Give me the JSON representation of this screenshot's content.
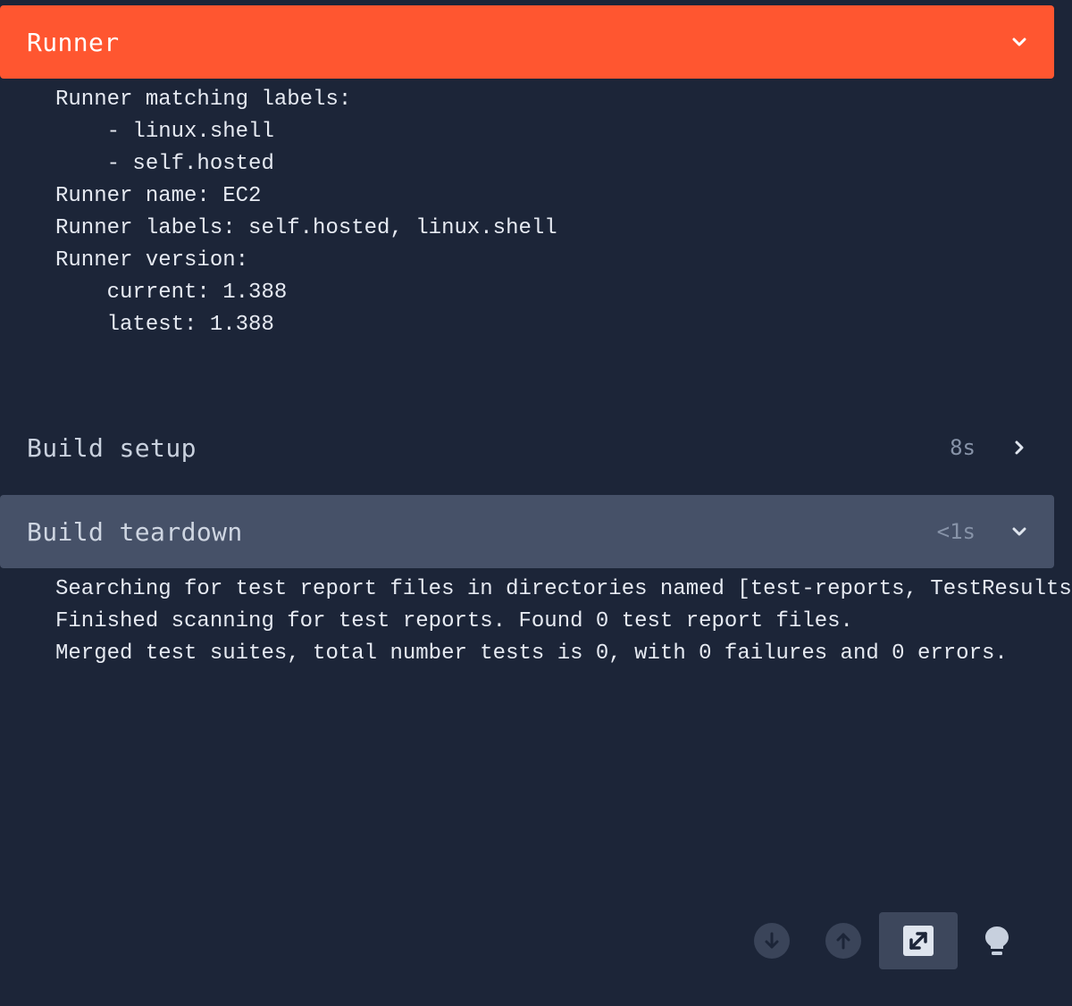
{
  "steps": {
    "runner": {
      "title": "Runner",
      "log": [
        "Runner matching labels:",
        "    - linux.shell",
        "    - self.hosted",
        "Runner name: EC2",
        "Runner labels: self.hosted, linux.shell",
        "Runner version:",
        "    current: 1.388",
        "    latest: 1.388"
      ]
    },
    "build_setup": {
      "title": "Build setup",
      "duration": "8s"
    },
    "build_teardown": {
      "title": "Build teardown",
      "duration": "<1s",
      "log": [
        "Searching for test report files in directories named [test-reports, TestResults",
        "Finished scanning for test reports. Found 0 test report files.",
        "Merged test suites, total number tests is 0, with 0 failures and 0 errors."
      ]
    }
  },
  "toolbar": {
    "icons": [
      "arrow-down-icon",
      "arrow-up-icon",
      "expand-icon",
      "lightbulb-icon"
    ]
  },
  "colors": {
    "background": "#1c2538",
    "runner_header": "#ff5630",
    "teardown_header": "#465168"
  }
}
